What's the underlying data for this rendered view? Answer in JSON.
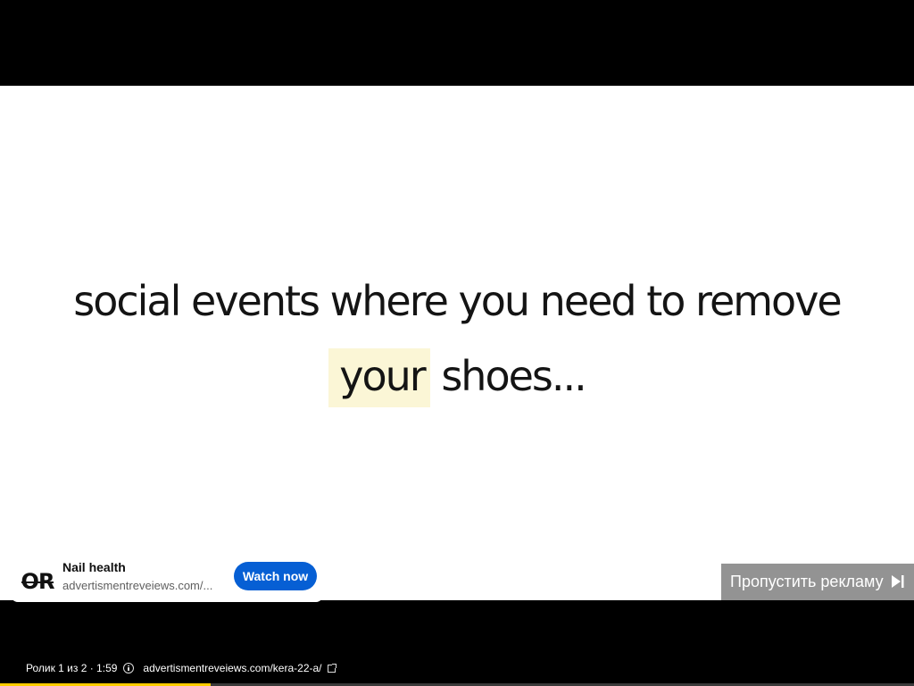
{
  "caption": {
    "line1": "social events where you need to remove",
    "highlight": "your",
    "line2_rest": " shoes..."
  },
  "ad": {
    "logo_letters": "OR",
    "title": "Nail health",
    "url": "advertismentreveiews.com/...",
    "cta": "Watch now",
    "cta_color": "#065fd4"
  },
  "skip": {
    "label": "Пропустить рекламу",
    "icon": "skip-next-icon"
  },
  "info": {
    "position_text": "Ролик 1 из 2 · 1:59",
    "link_text": "advertismentreveiews.com/kera-22-a/"
  },
  "progress": {
    "value_fraction": 0.23,
    "color": "#ffcc00"
  }
}
